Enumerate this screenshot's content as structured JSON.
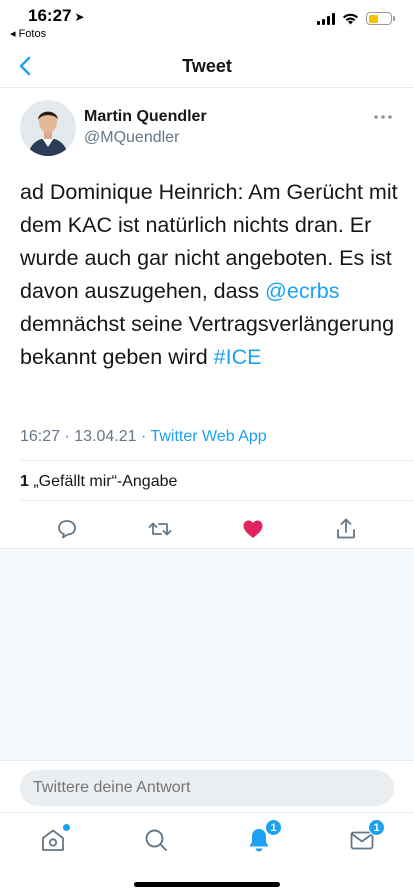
{
  "status_bar": {
    "time": "16:27",
    "back_app": "◂ Fotos",
    "battery_color": "#f5c400"
  },
  "nav": {
    "title": "Tweet"
  },
  "tweet": {
    "author_name": "Martin Quendler",
    "author_handle": "@MQuendler",
    "text_part1": "ad Dominique Heinrich: Am Gerücht mit dem KAC ist natürlich nichts dran. Er wurde auch gar nicht angeboten. Es ist davon auszugehen, dass ",
    "mention": "@ecrbs",
    "text_part2": " demnächst seine Vertragsverlängerung bekannt geben wird ",
    "hashtag": "#ICE",
    "time": "16:27",
    "date": "13.04.21",
    "source": "Twitter Web App",
    "like_count": "1",
    "like_label": " „Gefällt mir“-Angabe"
  },
  "actions": {
    "reply_icon": "comment-icon",
    "retweet_icon": "retweet-icon",
    "like_icon": "heart-icon",
    "share_icon": "share-icon",
    "like_active_color": "#e0245e"
  },
  "reply": {
    "placeholder": "Twittere deine Antwort"
  },
  "tab_bar": {
    "notifications_badge": "1",
    "messages_badge": "1"
  },
  "colors": {
    "accent": "#1da1f2",
    "text_secondary": "#657786"
  }
}
